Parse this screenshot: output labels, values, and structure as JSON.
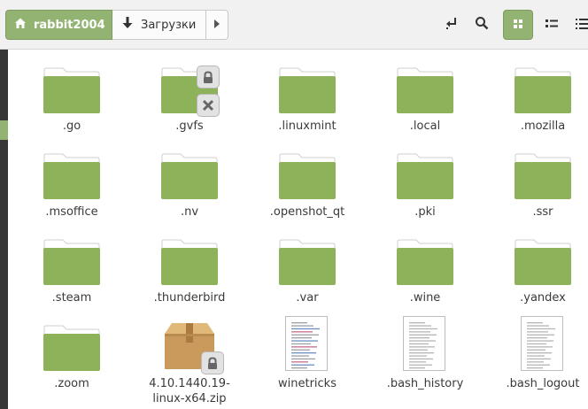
{
  "toolbar": {
    "breadcrumbs": [
      {
        "label": "rabbit2004",
        "icon": "home-icon"
      },
      {
        "label": "Загрузки",
        "icon": "download-icon"
      }
    ],
    "buttons": [
      "toggle-location-icon",
      "search-icon",
      "icon-view-icon",
      "list-view-icon",
      "compact-view-icon"
    ]
  },
  "colors": {
    "accent": "#92b372",
    "folder": "#8db25a",
    "folder_tab": "#ffffff",
    "sidebar": "#373737"
  },
  "files": [
    {
      "name": ".go",
      "type": "folder"
    },
    {
      "name": ".gvfs",
      "type": "folder",
      "emblems": [
        "lock",
        "unreadable"
      ]
    },
    {
      "name": ".linuxmint",
      "type": "folder"
    },
    {
      "name": ".local",
      "type": "folder"
    },
    {
      "name": ".mozilla",
      "type": "folder"
    },
    {
      "name": ".msoffice",
      "type": "folder"
    },
    {
      "name": ".nv",
      "type": "folder"
    },
    {
      "name": ".openshot_qt",
      "type": "folder"
    },
    {
      "name": ".pki",
      "type": "folder"
    },
    {
      "name": ".ssr",
      "type": "folder"
    },
    {
      "name": ".steam",
      "type": "folder"
    },
    {
      "name": ".thunderbird",
      "type": "folder"
    },
    {
      "name": ".var",
      "type": "folder"
    },
    {
      "name": ".wine",
      "type": "folder"
    },
    {
      "name": ".yandex",
      "type": "folder"
    },
    {
      "name": ".zoom",
      "type": "folder"
    },
    {
      "name": "4.10.1440.19-\nlinux-x64.zip",
      "type": "archive",
      "emblems": [
        "lock"
      ]
    },
    {
      "name": "winetricks",
      "type": "script"
    },
    {
      "name": ".bash_history",
      "type": "text"
    },
    {
      "name": ".bash_logout",
      "type": "text"
    }
  ]
}
